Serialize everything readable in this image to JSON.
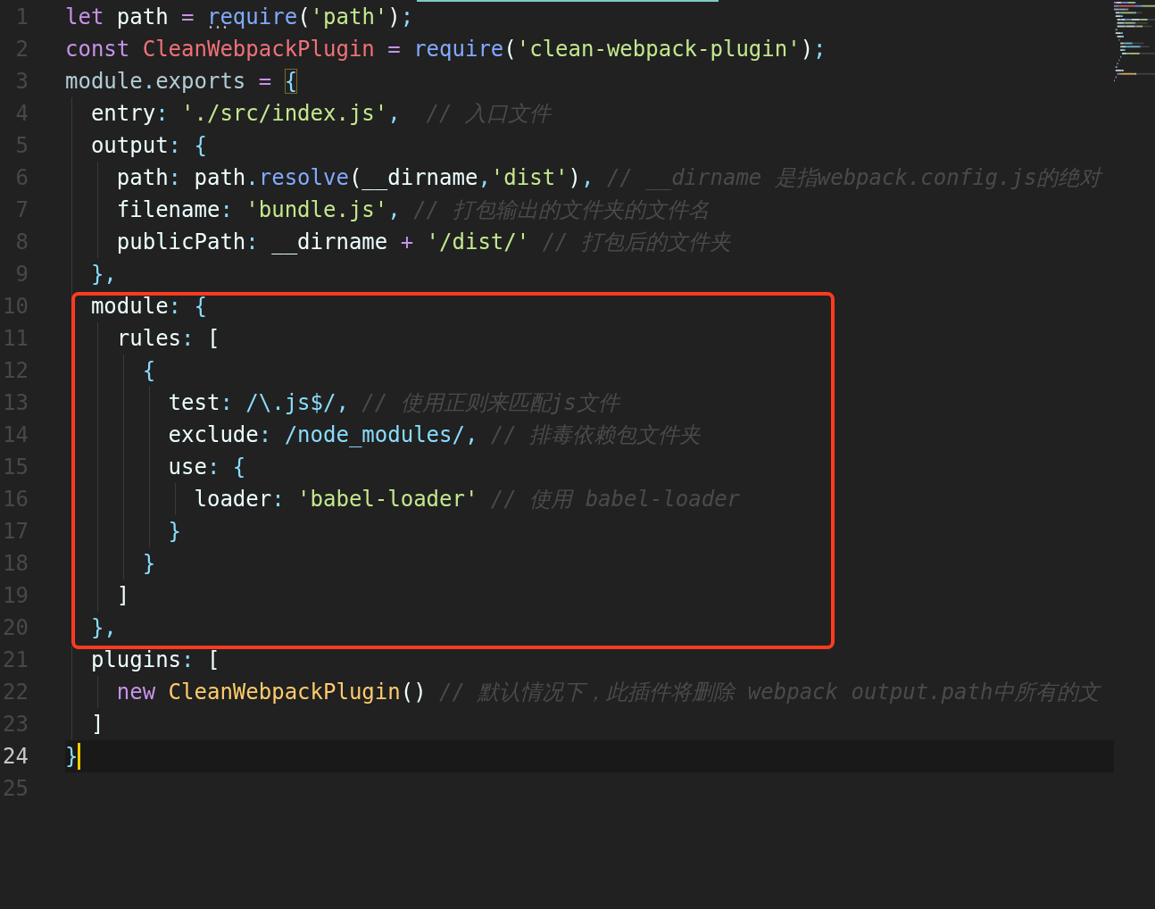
{
  "editor": {
    "lines": [
      {
        "kind": "line",
        "number": "1",
        "tokens": [
          {
            "kind": "keyword",
            "text": "let"
          },
          {
            "kind": "plain",
            "text": " path "
          },
          {
            "kind": "operator",
            "text": "= "
          },
          {
            "kind": "function",
            "text": "require",
            "hint": true
          },
          {
            "kind": "plain",
            "text": "("
          },
          {
            "kind": "string",
            "text": "'path'"
          },
          {
            "kind": "plain",
            "text": ")"
          },
          {
            "kind": "punct",
            "text": ";"
          }
        ]
      },
      {
        "kind": "line",
        "number": "2",
        "tokens": [
          {
            "kind": "keyword",
            "text": "const "
          },
          {
            "kind": "variable",
            "text": "CleanWebpackPlugin "
          },
          {
            "kind": "operator",
            "text": "= "
          },
          {
            "kind": "function",
            "text": "require"
          },
          {
            "kind": "plain",
            "text": "("
          },
          {
            "kind": "string",
            "text": "'clean-webpack-plugin'"
          },
          {
            "kind": "plain",
            "text": ")"
          },
          {
            "kind": "punct",
            "text": ";"
          }
        ]
      },
      {
        "kind": "line",
        "number": "3",
        "tokens": [
          {
            "kind": "object",
            "text": "module"
          },
          {
            "kind": "punct",
            "text": "."
          },
          {
            "kind": "object",
            "text": "exports "
          },
          {
            "kind": "operator",
            "text": "= "
          },
          {
            "kind": "punct",
            "text": "{",
            "bracket_match": true
          }
        ],
        "children": [
          {
            "kind": "line",
            "number": "4",
            "tokens": [
              {
                "kind": "plain",
                "text": "entry"
              },
              {
                "kind": "punct",
                "text": ": "
              },
              {
                "kind": "string",
                "text": "'./src/index.js'"
              },
              {
                "kind": "punct",
                "text": ",  "
              },
              {
                "kind": "comment",
                "text": "// 入口文件"
              }
            ]
          },
          {
            "kind": "line",
            "number": "5",
            "tokens": [
              {
                "kind": "plain",
                "text": "output"
              },
              {
                "kind": "punct",
                "text": ": {"
              }
            ],
            "children": [
              {
                "kind": "line",
                "number": "6",
                "tokens": [
                  {
                    "kind": "plain",
                    "text": "path"
                  },
                  {
                    "kind": "punct",
                    "text": ":"
                  },
                  {
                    "kind": "plain",
                    "text": " path"
                  },
                  {
                    "kind": "punct",
                    "text": "."
                  },
                  {
                    "kind": "function",
                    "text": "resolve"
                  },
                  {
                    "kind": "plain",
                    "text": "(__dirname"
                  },
                  {
                    "kind": "punct",
                    "text": ","
                  },
                  {
                    "kind": "string",
                    "text": "'dist'"
                  },
                  {
                    "kind": "plain",
                    "text": ")"
                  },
                  {
                    "kind": "punct",
                    "text": ", "
                  },
                  {
                    "kind": "comment",
                    "text": "// __dirname 是指webpack.config.js的绝对"
                  }
                ]
              },
              {
                "kind": "line",
                "number": "7",
                "tokens": [
                  {
                    "kind": "plain",
                    "text": "filename"
                  },
                  {
                    "kind": "punct",
                    "text": ": "
                  },
                  {
                    "kind": "string",
                    "text": "'bundle.js'"
                  },
                  {
                    "kind": "punct",
                    "text": ", "
                  },
                  {
                    "kind": "comment",
                    "text": "// 打包输出的文件夹的文件名"
                  }
                ]
              },
              {
                "kind": "line",
                "number": "8",
                "tokens": [
                  {
                    "kind": "plain",
                    "text": "publicPath"
                  },
                  {
                    "kind": "punct",
                    "text": ":"
                  },
                  {
                    "kind": "plain",
                    "text": " __dirname "
                  },
                  {
                    "kind": "operator",
                    "text": "+ "
                  },
                  {
                    "kind": "string",
                    "text": "'/dist/'"
                  },
                  {
                    "kind": "comment",
                    "text": " // 打包后的文件夹"
                  }
                ]
              }
            ]
          },
          {
            "kind": "line",
            "number": "9",
            "tokens": [
              {
                "kind": "punct",
                "text": "},"
              }
            ]
          },
          {
            "kind": "frame",
            "lines": [
              {
                "kind": "line",
                "number": "10",
                "tokens": [
                  {
                    "kind": "plain",
                    "text": "module"
                  },
                  {
                    "kind": "punct",
                    "text": ": {"
                  }
                ],
                "children": [
                  {
                    "kind": "line",
                    "number": "11",
                    "tokens": [
                      {
                        "kind": "plain",
                        "text": "rules"
                      },
                      {
                        "kind": "punct",
                        "text": ":"
                      },
                      {
                        "kind": "plain",
                        "text": " ["
                      }
                    ],
                    "children": [
                      {
                        "kind": "line",
                        "number": "12",
                        "tokens": [
                          {
                            "kind": "punct",
                            "text": "{"
                          }
                        ],
                        "children": [
                          {
                            "kind": "line",
                            "number": "13",
                            "tokens": [
                              {
                                "kind": "plain",
                                "text": "test"
                              },
                              {
                                "kind": "punct",
                                "text": ": "
                              },
                              {
                                "kind": "regex",
                                "text": "/\\.js$/"
                              },
                              {
                                "kind": "punct",
                                "text": ", "
                              },
                              {
                                "kind": "comment",
                                "text": "// 使用正则来匹配js文件"
                              }
                            ]
                          },
                          {
                            "kind": "line",
                            "number": "14",
                            "tokens": [
                              {
                                "kind": "plain",
                                "text": "exclude"
                              },
                              {
                                "kind": "punct",
                                "text": ": "
                              },
                              {
                                "kind": "regex",
                                "text": "/node_modules/"
                              },
                              {
                                "kind": "punct",
                                "text": ", "
                              },
                              {
                                "kind": "comment",
                                "text": "// 排毒依赖包文件夹"
                              }
                            ]
                          },
                          {
                            "kind": "line",
                            "number": "15",
                            "tokens": [
                              {
                                "kind": "plain",
                                "text": "use"
                              },
                              {
                                "kind": "punct",
                                "text": ": {"
                              }
                            ],
                            "children": [
                              {
                                "kind": "line",
                                "number": "16",
                                "tokens": [
                                  {
                                    "kind": "plain",
                                    "text": "loader"
                                  },
                                  {
                                    "kind": "punct",
                                    "text": ": "
                                  },
                                  {
                                    "kind": "string",
                                    "text": "'babel-loader'"
                                  },
                                  {
                                    "kind": "comment",
                                    "text": " // 使用 babel-loader"
                                  }
                                ]
                              }
                            ]
                          },
                          {
                            "kind": "line",
                            "number": "17",
                            "tokens": [
                              {
                                "kind": "punct",
                                "text": "}"
                              }
                            ]
                          }
                        ]
                      },
                      {
                        "kind": "line",
                        "number": "18",
                        "tokens": [
                          {
                            "kind": "punct",
                            "text": "}"
                          }
                        ]
                      }
                    ]
                  },
                  {
                    "kind": "line",
                    "number": "19",
                    "tokens": [
                      {
                        "kind": "plain",
                        "text": "]"
                      }
                    ]
                  }
                ]
              },
              {
                "kind": "line",
                "number": "20",
                "tokens": [
                  {
                    "kind": "punct",
                    "text": "},"
                  }
                ]
              }
            ]
          },
          {
            "kind": "line",
            "number": "21",
            "tokens": [
              {
                "kind": "plain",
                "text": "plugins"
              },
              {
                "kind": "punct",
                "text": ":"
              },
              {
                "kind": "plain",
                "text": " ["
              }
            ],
            "children": [
              {
                "kind": "line",
                "number": "22",
                "tokens": [
                  {
                    "kind": "keyword",
                    "text": "new "
                  },
                  {
                    "kind": "class",
                    "text": "CleanWebpackPlugin"
                  },
                  {
                    "kind": "plain",
                    "text": "()"
                  },
                  {
                    "kind": "comment",
                    "text": " // 默认情况下，此插件将删除 webpack output.path中所有的文"
                  }
                ]
              }
            ]
          },
          {
            "kind": "line",
            "number": "23",
            "tokens": [
              {
                "kind": "plain",
                "text": "]"
              }
            ]
          }
        ]
      },
      {
        "kind": "line",
        "number": "24",
        "current": true,
        "tokens": [
          {
            "kind": "punct",
            "text": "}"
          }
        ]
      },
      {
        "kind": "line",
        "number": "25"
      }
    ]
  }
}
